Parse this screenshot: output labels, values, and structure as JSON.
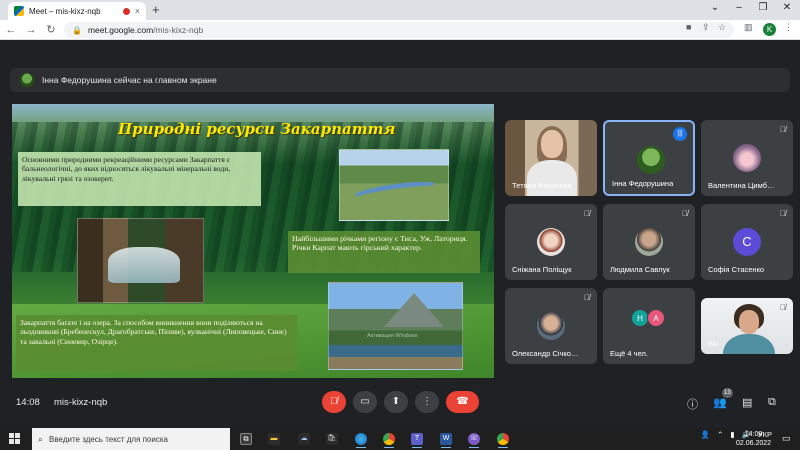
{
  "browser": {
    "tab_title": "Meet – mis-kixz-nqb",
    "tab_close": "×",
    "new_tab": "+",
    "url_domain": "meet.google.com",
    "url_path": "/mis-kixz-nqb",
    "profile_letter": "K",
    "colors": {
      "profile": "#188038"
    }
  },
  "meet": {
    "banner_text": "Інна Федорушина сейчас на главном экране",
    "time": "14:08",
    "meeting_code": "mis-kixz-nqb",
    "participant_count": "13",
    "colors": {
      "hangup": "#ea4335",
      "active_border": "#8ab4f8",
      "tile": "#3c4043"
    }
  },
  "slide": {
    "title": "Природні ресурси Закарпаття",
    "box1": "Основними природними рекреаційними ресурсами Закарпаття є бальнеологічні, до яких відносяться лікувальні мінеральні води, лікувальні грязі та озокерит.",
    "box2": "Найбільшими річками регіону є Тиса, Уж, Латориця. Річки Карпат мають гірський характер.",
    "box3": "Закарпаття багате і на озера. За способом виникнення вони поділяються на льодовикові (Бребенескул, Драгобратське, Піпиве), вулканічні (Липовецьке, Синє) та завальні (Синевир, Озірце).",
    "watermark": "Активация Windows"
  },
  "participants": [
    {
      "name": "Тетяна Фарсєєва"
    },
    {
      "name": "Інна Федорушина"
    },
    {
      "name": "Валентина Цимб…",
      "letter": ""
    },
    {
      "name": "Сніжана Поліщук"
    },
    {
      "name": "Людмила Савлук"
    },
    {
      "name": "Софія Стасенко",
      "letter": "С",
      "color": "#5b4bd6"
    },
    {
      "name": "Олександр Січко…"
    },
    {
      "name": "Ещё 4 чел.",
      "avatars": [
        "Н",
        "А"
      ],
      "colors": [
        "#12a39a",
        "#e8577a"
      ]
    },
    {
      "name": "Вы"
    }
  ],
  "taskbar": {
    "search_placeholder": "Введите здесь текст для поиска",
    "lang": "УКР",
    "time": "14:08",
    "date": "02.06.2022"
  }
}
